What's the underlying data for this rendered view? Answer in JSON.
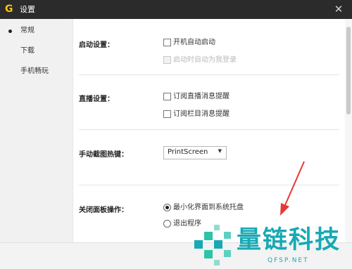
{
  "window": {
    "title": "设置",
    "logo_char": "G"
  },
  "sidebar": {
    "items": [
      {
        "label": "常规",
        "selected": true
      },
      {
        "label": "下载",
        "selected": false
      },
      {
        "label": "手机畅玩",
        "selected": false
      }
    ]
  },
  "startup": {
    "label": "启动设置：",
    "opt1": "开机自动启动",
    "opt2": "启动时自动为我登录"
  },
  "live": {
    "label": "直播设置：",
    "opt1": "订阅直播消息提醒",
    "opt2": "订阅栏目消息提醒"
  },
  "hotkey": {
    "label": "手动截图热键：",
    "value": "PrintScreen"
  },
  "close_panel": {
    "label": "关闭面板操作：",
    "opt1": "最小化界面到系统托盘",
    "opt2": "退出程序"
  },
  "watermark": {
    "name": "量链科技",
    "domain": "QFSP.NET"
  },
  "colors": {
    "titlebar": "#2b2b2b",
    "accent": "#f5c518",
    "arrow": "#e53935",
    "watermark": "#17a9b4"
  }
}
